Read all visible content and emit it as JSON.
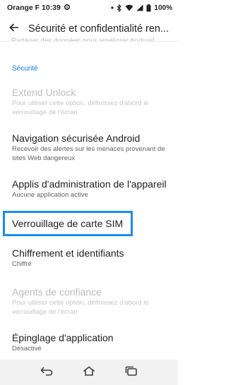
{
  "status_bar": {
    "carrier_time": "Orange F 10:39",
    "battery": "100%"
  },
  "app_bar": {
    "title": "Sécurité et confidentialité ren..."
  },
  "clipped_summary": "Partager des données pour améliorer Android",
  "section": {
    "header": "Sécurité"
  },
  "preferences": [
    {
      "title": "Extend Unlock",
      "summary": "Pour utiliser cette option, définissez d'abord le verrouillage de l'écran",
      "enabled": false
    },
    {
      "title": "Navigation sécurisée Android",
      "summary": "Recevoir des alertes sur les menaces provenant de sites Web dangereux",
      "enabled": true
    },
    {
      "title": "Applis d'administration de l'appareil",
      "summary": "Aucune application active",
      "enabled": true
    },
    {
      "title": "Verrouillage de carte SIM",
      "summary": "",
      "enabled": true
    },
    {
      "title": "Chiffrement et identifiants",
      "summary": "Chiffré",
      "enabled": true
    },
    {
      "title": "Agents de confiance",
      "summary": "Pour utiliser cette option, définissez d'abord le verrouillage de l'écran",
      "enabled": false
    },
    {
      "title": "Épinglage d'application",
      "summary": "Désactivé",
      "enabled": true
    }
  ],
  "icons": {
    "back": "arrow-back-icon",
    "nav_back": "nav-back-icon",
    "nav_home": "nav-home-icon",
    "nav_recents": "nav-recents-icon"
  },
  "colors": {
    "accent": "#1a73e8",
    "highlight": "#1a8cf0",
    "disabled_text": "#bdbdbd"
  }
}
